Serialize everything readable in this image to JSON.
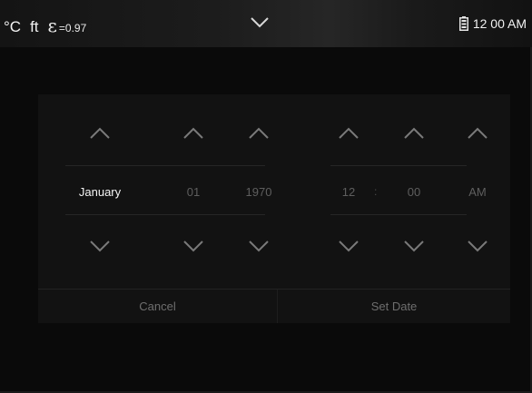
{
  "statusbar": {
    "temp_unit": "°C",
    "distance_unit": "ft",
    "emissivity_symbol": "ε",
    "emissivity_value": "=0.97",
    "dropdown_icon": "chevron-down-icon",
    "battery_icon": "battery-icon",
    "time": "12 00 AM"
  },
  "picker": {
    "month": "January",
    "day": "01",
    "year": "1970",
    "hour": "12",
    "colon": ":",
    "minute": "00",
    "ampm": "AM",
    "up_icon": "chevron-up-icon",
    "down_icon": "chevron-down-icon"
  },
  "actions": {
    "cancel_label": "Cancel",
    "set_label": "Set Date"
  },
  "colors": {
    "background": "#0a0a0a",
    "panel": "#121212",
    "text_primary": "#ffffff",
    "text_dim": "#6e6e6e",
    "arrow": "#7a7a7a"
  }
}
